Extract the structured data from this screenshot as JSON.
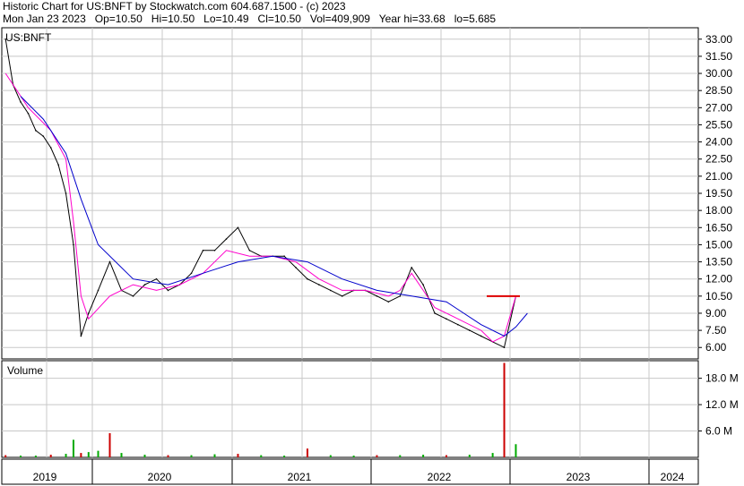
{
  "header": {
    "line1": "Historic Chart for US:BNFT by Stockwatch.com 604.687.1500 - (c) 2023",
    "line2": "Mon Jan 23 2023   Op=10.50   Hi=10.50   Lo=10.49   Cl=10.50   Vol=409,909   Year hi=33.68   lo=5.685"
  },
  "colors": {
    "price": "#000000",
    "ma_short": "#ff00cc",
    "ma_long": "#0000cc",
    "volume_up": "#00aa00",
    "volume_down": "#cc0000",
    "grid": "#c8c8c8",
    "last_price": "#dd0000"
  },
  "chart_data": [
    {
      "type": "line",
      "title": "US:BNFT",
      "ylim": [
        5.0,
        34.0
      ],
      "y_ticks": [
        "33.00",
        "31.50",
        "30.00",
        "28.50",
        "27.00",
        "25.50",
        "24.00",
        "22.50",
        "21.00",
        "19.50",
        "18.00",
        "16.50",
        "15.00",
        "13.50",
        "12.00",
        "10.50",
        "9.00",
        "7.50",
        "6.00"
      ],
      "x_labels": [
        "2019",
        "2020",
        "2021",
        "2022",
        "2023",
        "2024"
      ],
      "series": [
        {
          "role": "price",
          "x": [
            "2019-01",
            "2019-02",
            "2019-03",
            "2019-04",
            "2019-05",
            "2019-06",
            "2019-07",
            "2019-08",
            "2019-09",
            "2019-10",
            "2019-11",
            "2019-12",
            "2020-01",
            "2020-02",
            "2020-03",
            "2020-04",
            "2020-05",
            "2020-06",
            "2020-07",
            "2020-08",
            "2020-09",
            "2020-10",
            "2020-11",
            "2020-12",
            "2021-01",
            "2021-02",
            "2021-03",
            "2021-04",
            "2021-05",
            "2021-06",
            "2021-07",
            "2021-08",
            "2021-09",
            "2021-10",
            "2021-11",
            "2021-12",
            "2022-01",
            "2022-02",
            "2022-03",
            "2022-04",
            "2022-05",
            "2022-06",
            "2022-07",
            "2022-08",
            "2022-09",
            "2022-10",
            "2022-11",
            "2022-12",
            "2023-01"
          ],
          "values": [
            33.0,
            29.0,
            27.5,
            26.5,
            25.0,
            24.5,
            23.5,
            22.0,
            19.5,
            15.0,
            7.0,
            9.0,
            11.0,
            13.5,
            11.0,
            10.5,
            11.5,
            12.0,
            11.0,
            11.5,
            12.5,
            14.5,
            14.5,
            15.5,
            16.5,
            14.5,
            14.0,
            14.0,
            14.0,
            13.0,
            12.0,
            11.5,
            11.0,
            10.5,
            11.0,
            11.0,
            10.5,
            10.0,
            10.5,
            13.0,
            11.5,
            9.0,
            8.5,
            8.0,
            7.5,
            7.0,
            6.5,
            6.0,
            10.5
          ]
        },
        {
          "role": "ma_short",
          "x": [
            "2019-01",
            "2019-04",
            "2019-07",
            "2019-09",
            "2019-10",
            "2019-11",
            "2019-12",
            "2020-02",
            "2020-04",
            "2020-06",
            "2020-08",
            "2020-10",
            "2020-12",
            "2021-02",
            "2021-04",
            "2021-06",
            "2021-08",
            "2021-10",
            "2021-12",
            "2022-02",
            "2022-03",
            "2022-04",
            "2022-05",
            "2022-06",
            "2022-08",
            "2022-10",
            "2022-11",
            "2022-12",
            "2023-01"
          ],
          "values": [
            30.0,
            27.0,
            25.0,
            22.5,
            17.0,
            10.5,
            8.5,
            10.5,
            11.5,
            11.0,
            11.5,
            12.5,
            14.5,
            14.0,
            14.0,
            13.5,
            12.0,
            11.0,
            11.0,
            10.5,
            11.0,
            12.5,
            11.0,
            9.5,
            8.5,
            7.5,
            6.5,
            7.0,
            10.5
          ]
        },
        {
          "role": "ma_long",
          "x": [
            "2019-03",
            "2019-06",
            "2019-09",
            "2019-11",
            "2020-01",
            "2020-04",
            "2020-07",
            "2020-10",
            "2021-01",
            "2021-04",
            "2021-07",
            "2021-10",
            "2022-01",
            "2022-04",
            "2022-07",
            "2022-10",
            "2022-12",
            "2023-01",
            "2023-02"
          ],
          "values": [
            28.0,
            26.0,
            23.0,
            19.0,
            15.0,
            12.0,
            11.5,
            12.5,
            13.5,
            14.0,
            13.5,
            12.0,
            11.0,
            10.5,
            10.0,
            8.0,
            7.0,
            7.8,
            9.0
          ]
        }
      ]
    },
    {
      "type": "bar",
      "title": "Volume",
      "ylim": [
        0,
        22.0
      ],
      "y_ticks": [
        "18.0 M",
        "12.0 M",
        "6.0 M"
      ],
      "series": [
        {
          "role": "volume",
          "x": [
            "2019-01",
            "2019-03",
            "2019-05",
            "2019-07",
            "2019-09",
            "2019-10",
            "2019-11",
            "2019-12",
            "2020-01",
            "2020-02",
            "2020-03",
            "2020-05",
            "2020-07",
            "2020-09",
            "2020-11",
            "2021-01",
            "2021-03",
            "2021-05",
            "2021-07",
            "2021-09",
            "2021-11",
            "2022-01",
            "2022-03",
            "2022-05",
            "2022-07",
            "2022-09",
            "2022-11",
            "2022-12",
            "2023-01"
          ],
          "values": [
            0.5,
            0.4,
            0.4,
            0.6,
            0.8,
            4.0,
            1.0,
            1.2,
            1.5,
            5.5,
            1.0,
            0.6,
            0.5,
            0.5,
            0.7,
            0.8,
            0.5,
            0.4,
            2.0,
            0.5,
            0.4,
            0.5,
            0.5,
            0.6,
            0.5,
            0.6,
            1.0,
            21.5,
            3.0
          ]
        }
      ]
    }
  ]
}
